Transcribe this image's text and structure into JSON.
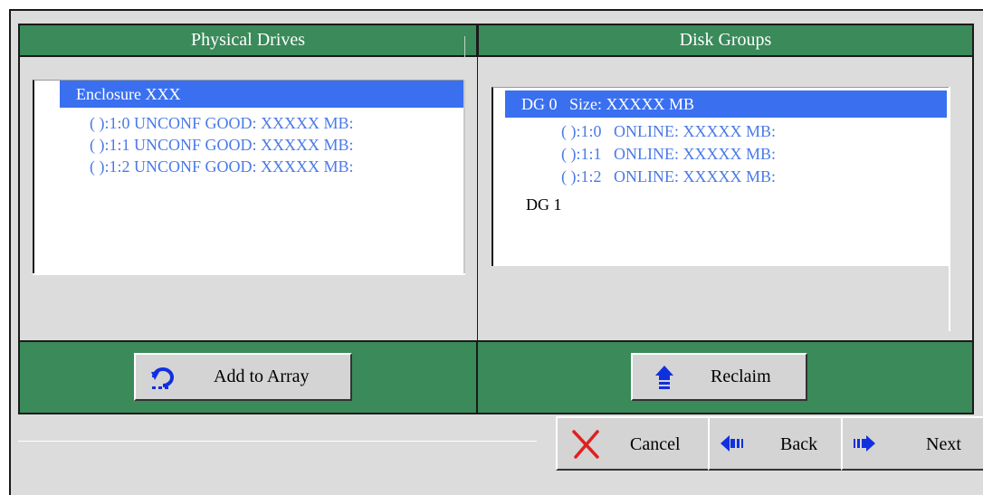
{
  "physical_drives": {
    "header": "Physical Drives",
    "enclosure": "Enclosure XXX",
    "drives": [
      "( ):1:0 UNCONF GOOD: XXXXX MB:",
      "( ):1:1 UNCONF GOOD: XXXXX MB:",
      "( ):1:2 UNCONF GOOD: XXXXX MB:"
    ],
    "button_label": "Add to Array"
  },
  "disk_groups": {
    "header": "Disk Groups",
    "groups": [
      {
        "label": "DG 0   Size: XXXXX MB",
        "drives": [
          "( ):1:0   ONLINE: XXXXX MB:",
          "( ):1:1   ONLINE: XXXXX MB:",
          "( ):1:2   ONLINE: XXXXX MB:"
        ]
      },
      {
        "label": "DG 1",
        "drives": []
      }
    ],
    "button_label": "Reclaim"
  },
  "nav": {
    "cancel": "Cancel",
    "back": "Back",
    "next": "Next"
  },
  "colors": {
    "header_green": "#3a8a5a",
    "selection_blue": "#3a70f0",
    "tree_text_blue": "#4a7ae8",
    "icon_blue": "#1030e0",
    "cancel_red": "#e02020"
  },
  "icons": {
    "add": "add-to-array-icon",
    "reclaim": "up-arrow-icon",
    "cancel": "x-icon",
    "back": "left-arrow-icon",
    "next": "right-arrow-icon"
  }
}
